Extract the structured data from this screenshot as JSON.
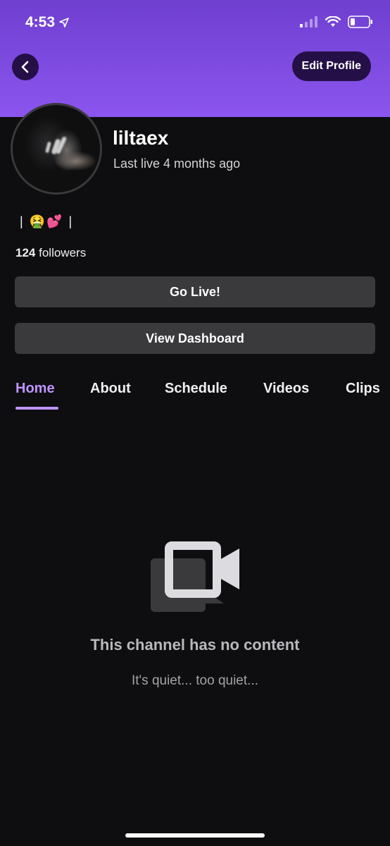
{
  "status_bar": {
    "time": "4:53",
    "icons": [
      "location-arrow-icon",
      "cellular-signal-icon",
      "wifi-icon",
      "battery-icon"
    ]
  },
  "header": {
    "back_icon": "chevron-left-icon",
    "edit_profile_label": "Edit Profile",
    "gradient_top": "#6f3fd0",
    "gradient_bottom": "#8b55ee"
  },
  "profile": {
    "username": "liltaex",
    "last_live": "Last live 4 months ago",
    "bio": "| 🤮💕 |",
    "followers_count": "124",
    "followers_label": "followers"
  },
  "actions": {
    "go_live_label": "Go Live!",
    "view_dashboard_label": "View Dashboard"
  },
  "tabs": [
    {
      "label": "Home",
      "active": true
    },
    {
      "label": "About",
      "active": false
    },
    {
      "label": "Schedule",
      "active": false
    },
    {
      "label": "Videos",
      "active": false
    },
    {
      "label": "Clips",
      "active": false
    }
  ],
  "empty_state": {
    "icon": "video-camera-icon",
    "title": "This channel has no content",
    "subtitle": "It's quiet... too quiet..."
  },
  "colors": {
    "background": "#0e0e10",
    "accent": "#bf94ff",
    "button": "#3a3a3d",
    "header_button": "#241046"
  }
}
